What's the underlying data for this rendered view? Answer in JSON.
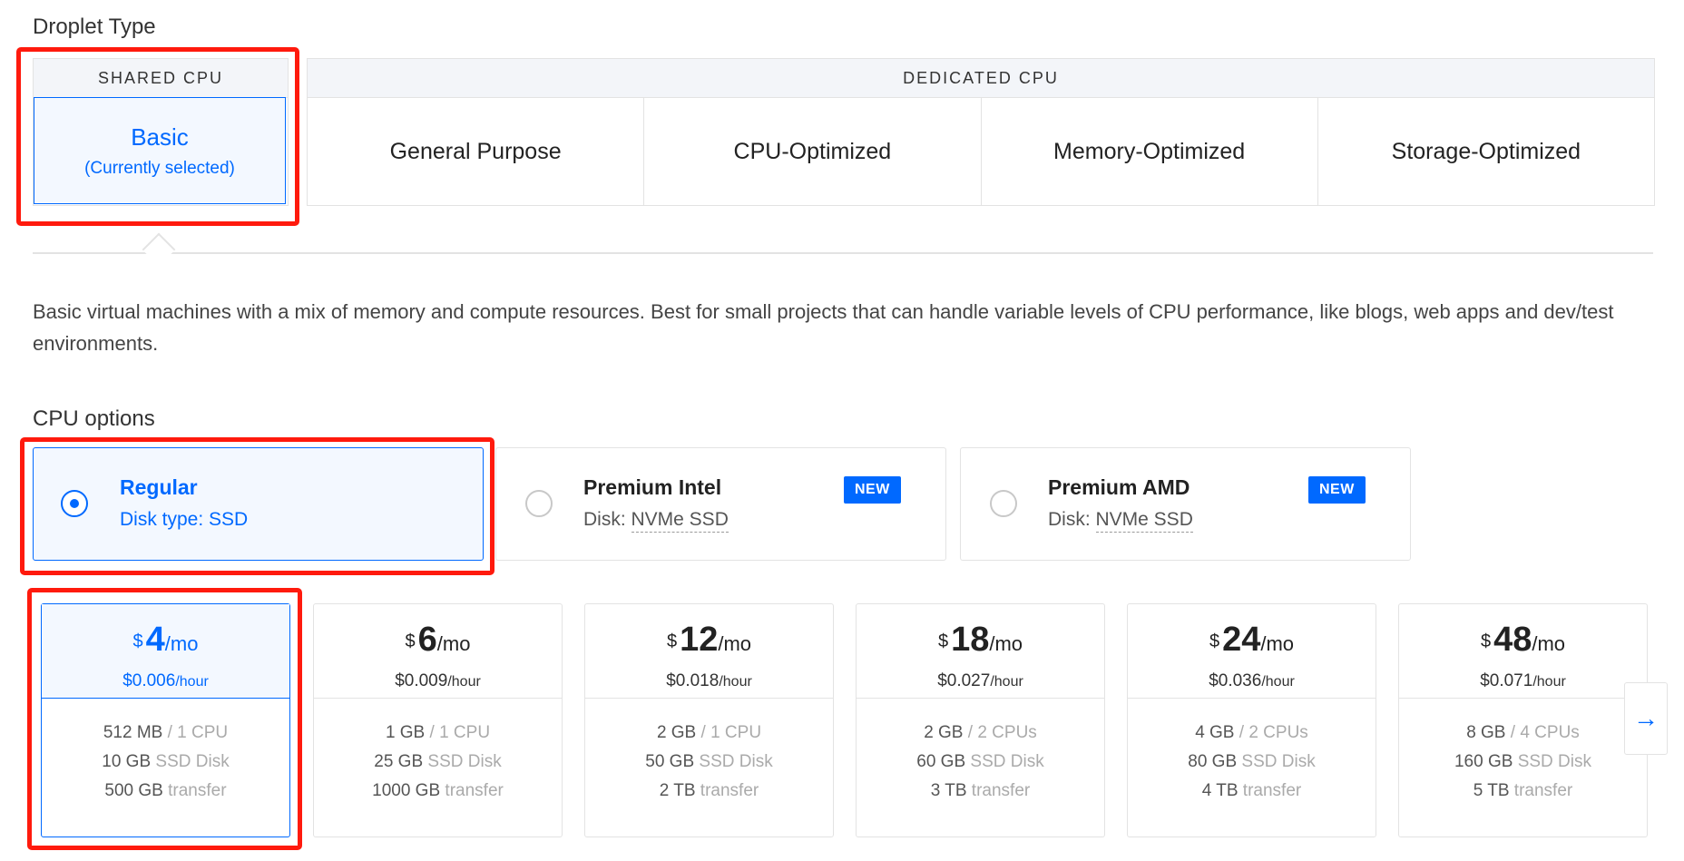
{
  "droplet_type": {
    "label": "Droplet Type",
    "shared": {
      "heading": "SHARED CPU",
      "option": {
        "title": "Basic",
        "subtitle": "(Currently selected)"
      }
    },
    "dedicated": {
      "heading": "DEDICATED CPU",
      "options": [
        "General Purpose",
        "CPU-Optimized",
        "Memory-Optimized",
        "Storage-Optimized"
      ]
    }
  },
  "description": "Basic virtual machines with a mix of memory and compute resources. Best for small projects that can handle variable levels of CPU performance, like blogs, web apps and dev/test environments.",
  "cpu_options": {
    "label": "CPU options",
    "items": [
      {
        "title": "Regular",
        "disk_prefix": "Disk type: ",
        "disk": "SSD",
        "selected": true,
        "badge": ""
      },
      {
        "title": "Premium Intel",
        "disk_prefix": "Disk: ",
        "disk": "NVMe SSD",
        "selected": false,
        "badge": "NEW"
      },
      {
        "title": "Premium AMD",
        "disk_prefix": "Disk: ",
        "disk": "NVMe SSD",
        "selected": false,
        "badge": "NEW"
      }
    ]
  },
  "plans": [
    {
      "currency": "$",
      "amount": "4",
      "per": "/mo",
      "hourly": "$0.006",
      "hour_unit": "/hour",
      "memory": "512 MB",
      "cpu": " / 1 CPU",
      "disk": "10 GB",
      "disk_unit": " SSD Disk",
      "transfer": "500 GB",
      "transfer_unit": " transfer",
      "selected": true
    },
    {
      "currency": "$",
      "amount": "6",
      "per": "/mo",
      "hourly": "$0.009",
      "hour_unit": "/hour",
      "memory": "1 GB",
      "cpu": " / 1 CPU",
      "disk": "25 GB",
      "disk_unit": " SSD Disk",
      "transfer": "1000 GB",
      "transfer_unit": " transfer",
      "selected": false
    },
    {
      "currency": "$",
      "amount": "12",
      "per": "/mo",
      "hourly": "$0.018",
      "hour_unit": "/hour",
      "memory": "2 GB",
      "cpu": " / 1 CPU",
      "disk": "50 GB",
      "disk_unit": " SSD Disk",
      "transfer": "2 TB",
      "transfer_unit": " transfer",
      "selected": false
    },
    {
      "currency": "$",
      "amount": "18",
      "per": "/mo",
      "hourly": "$0.027",
      "hour_unit": "/hour",
      "memory": "2 GB",
      "cpu": " / 2 CPUs",
      "disk": "60 GB",
      "disk_unit": " SSD Disk",
      "transfer": "3 TB",
      "transfer_unit": " transfer",
      "selected": false
    },
    {
      "currency": "$",
      "amount": "24",
      "per": "/mo",
      "hourly": "$0.036",
      "hour_unit": "/hour",
      "memory": "4 GB",
      "cpu": " / 2 CPUs",
      "disk": "80 GB",
      "disk_unit": " SSD Disk",
      "transfer": "4 TB",
      "transfer_unit": " transfer",
      "selected": false
    },
    {
      "currency": "$",
      "amount": "48",
      "per": "/mo",
      "hourly": "$0.071",
      "hour_unit": "/hour",
      "memory": "8 GB",
      "cpu": " / 4 CPUs",
      "disk": "160 GB",
      "disk_unit": " SSD Disk",
      "transfer": "5 TB",
      "transfer_unit": " transfer",
      "selected": false
    }
  ],
  "next_icon": "arrow-right-icon",
  "colors": {
    "accent": "#0069ff",
    "highlight": "#ff1a0d",
    "selected_bg": "#f3f8ff"
  }
}
